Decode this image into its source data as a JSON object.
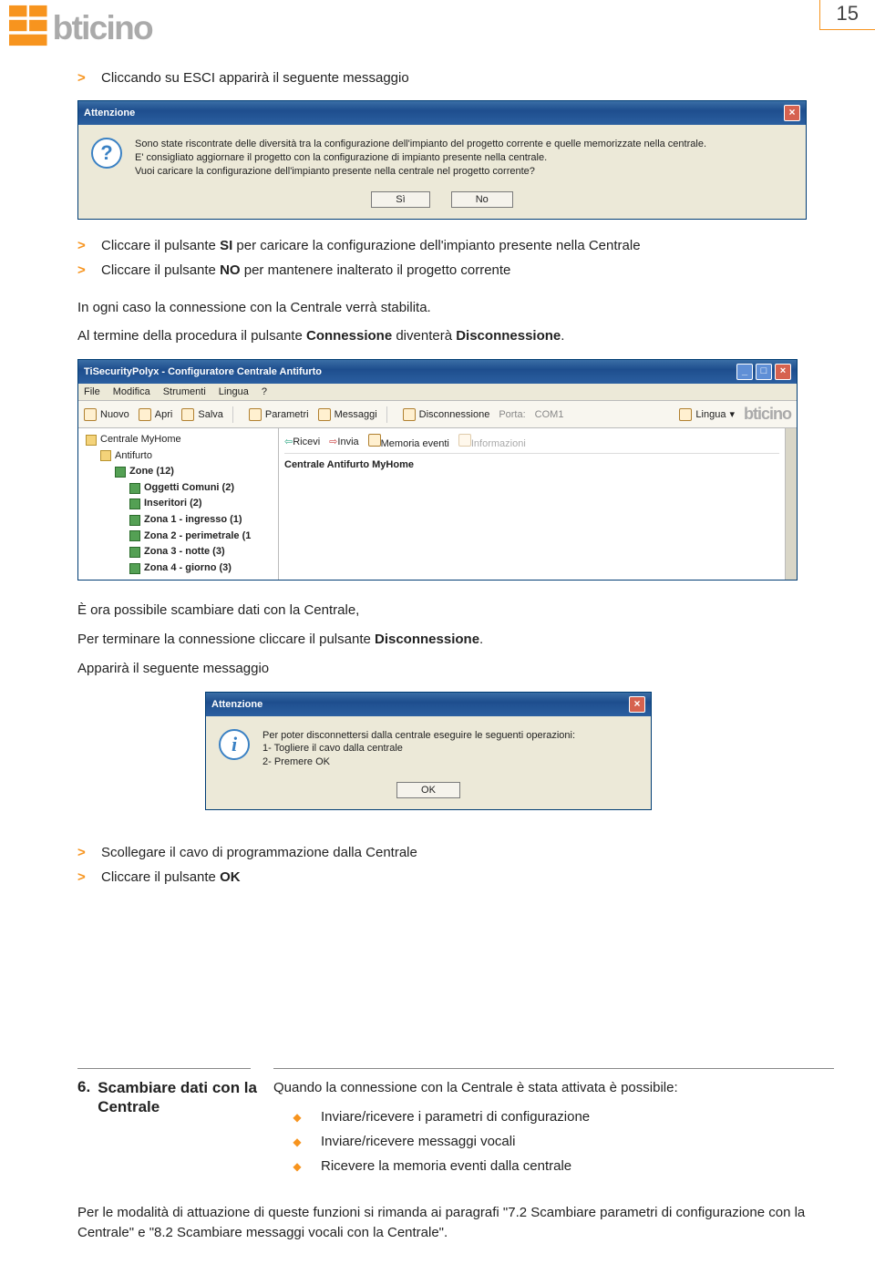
{
  "page_number": "15",
  "logo_text": "bticino",
  "intro_step": "Cliccando su ESCI apparirà il seguente messaggio",
  "dialog1": {
    "title": "Attenzione",
    "line1": "Sono state riscontrate delle diversità tra la configurazione dell'impianto del progetto corrente e quelle memorizzate nella centrale.",
    "line2": "E' consigliato aggiornare il progetto con la configurazione di impianto presente nella centrale.",
    "line3": "Vuoi caricare la configurazione dell'impianto presente nella centrale nel progetto corrente?",
    "btn_yes": "Sì",
    "btn_no": "No",
    "icon": "?"
  },
  "after1_l1a": "Cliccare il pulsante ",
  "after1_l1b": "SI",
  "after1_l1c": " per caricare la configurazione dell'impianto presente nella Centrale",
  "after1_l2a": "Cliccare il pulsante ",
  "after1_l2b": "NO",
  "after1_l2c": " per mantenere inalterato il progetto corrente",
  "after1_p1": "In ogni caso la connessione con la Centrale verrà stabilita.",
  "after1_p2a": "Al termine della procedura il pulsante ",
  "after1_p2b": "Connessione",
  "after1_p2c": " diventerà ",
  "after1_p2d": "Disconnessione",
  "after1_p2e": ".",
  "app": {
    "title": "TiSecurityPolyx - Configuratore Centrale Antifurto",
    "menu": [
      "File",
      "Modifica",
      "Strumenti",
      "Lingua",
      "?"
    ],
    "tb": {
      "nuovo": "Nuovo",
      "apri": "Apri",
      "salva": "Salva",
      "param": "Parametri",
      "msg": "Messaggi",
      "disc": "Disconnessione",
      "porta": "Porta:",
      "porta_v": "COM1",
      "lingua": "Lingua"
    },
    "sub": {
      "ricevi": "Ricevi",
      "invia": "Invia",
      "mem": "Memoria eventi",
      "info": "Informazioni"
    },
    "content_title": "Centrale Antifurto MyHome",
    "tree": {
      "root": "Centrale MyHome",
      "n1": "Antifurto",
      "n2": "Zone (12)",
      "items": [
        "Oggetti Comuni (2)",
        "Inseritori (2)",
        "Zona 1 - ingresso (1)",
        "Zona 2 - perimetrale (1",
        "Zona 3 - notte (3)",
        "Zona 4 - giorno (3)"
      ]
    }
  },
  "after2_p1": "È ora possibile scambiare dati con la Centrale,",
  "after2_p2a": "Per terminare la connessione cliccare il pulsante ",
  "after2_p2b": "Disconnessione",
  "after2_p2c": ".",
  "after2_p3": "Apparirà il seguente messaggio",
  "dialog2": {
    "title": "Attenzione",
    "line1": "Per poter disconnettersi dalla centrale eseguire le seguenti operazioni:",
    "line2": "1- Togliere il cavo dalla centrale",
    "line3": "2- Premere OK",
    "btn": "OK",
    "icon": "i"
  },
  "after3_l1": "Scollegare il cavo di programmazione dalla Centrale",
  "after3_l2a": "Cliccare il pulsante ",
  "after3_l2b": "OK",
  "section6": {
    "num": "6.",
    "title": "Scambiare dati con la Centrale",
    "intro": "Quando la connessione con la Centrale è stata attivata è possibile:",
    "b1": "Inviare/ricevere i parametri di configurazione",
    "b2": "Inviare/ricevere messaggi vocali",
    "b3": "Ricevere la memoria eventi dalla centrale",
    "foot": "Per le modalità di attuazione di queste funzioni si rimanda ai paragrafi \"7.2 Scambiare parametri di configurazione con la Centrale\" e \"8.2 Scambiare messaggi vocali con la Centrale\"."
  }
}
